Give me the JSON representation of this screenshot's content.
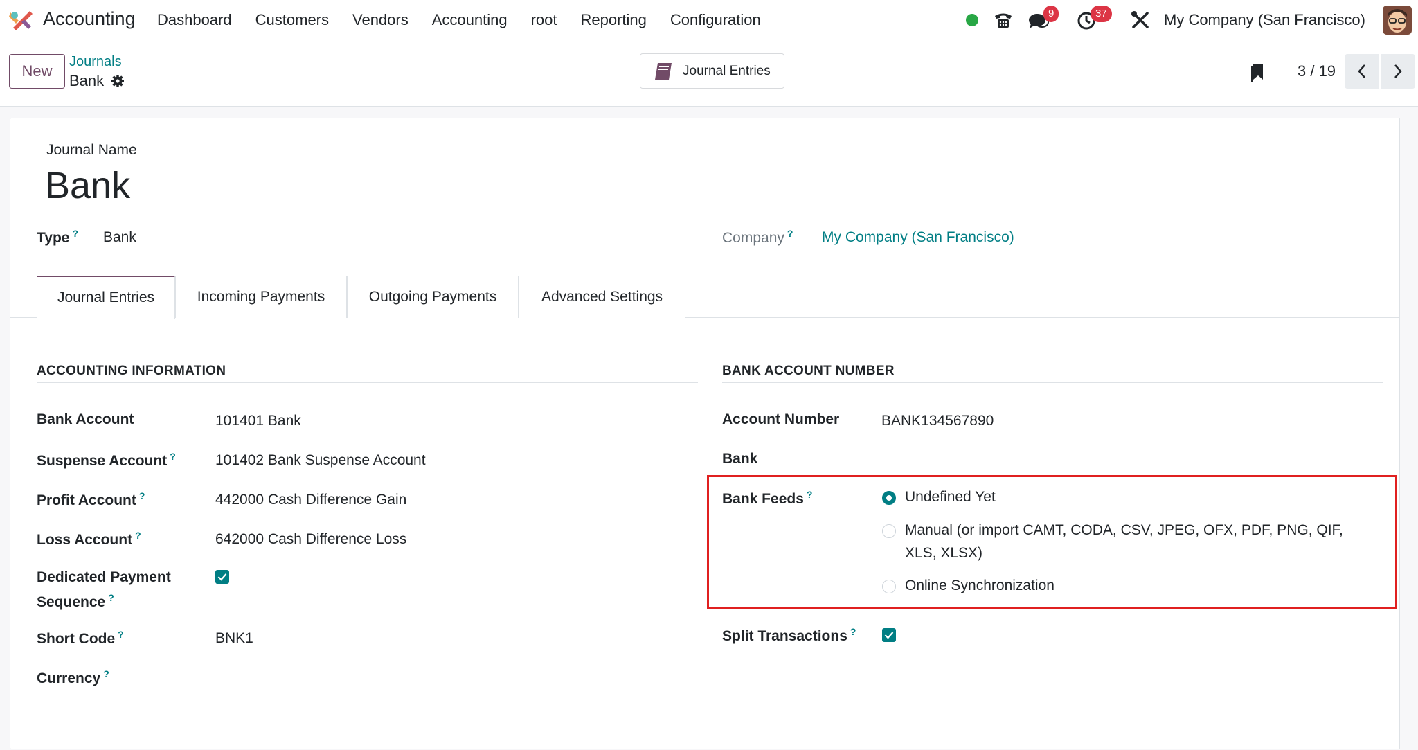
{
  "navbar": {
    "app_name": "Accounting",
    "menu": [
      "Dashboard",
      "Customers",
      "Vendors",
      "Accounting",
      "root",
      "Reporting",
      "Configuration"
    ],
    "messages_count": "9",
    "activities_count": "37",
    "company": "My Company (San Francisco)",
    "icons": [
      "app-logo-icon",
      "phone-icon",
      "chat-icon",
      "clock-icon",
      "tools-icon"
    ]
  },
  "control_panel": {
    "new_label": "New",
    "breadcrumb_parent": "Journals",
    "breadcrumb_current": "Bank",
    "smart_button": "Journal Entries",
    "pager": "3 / 19"
  },
  "form": {
    "journal_name_label": "Journal Name",
    "journal_name": "Bank",
    "type_label": "Type",
    "type_value": "Bank",
    "company_label": "Company",
    "company_value": "My Company (San Francisco)",
    "help_mark": "?",
    "tabs": [
      "Journal Entries",
      "Incoming Payments",
      "Outgoing Payments",
      "Advanced Settings"
    ],
    "accounting": {
      "title": "ACCOUNTING INFORMATION",
      "bank_account_label": "Bank Account",
      "bank_account": "101401 Bank",
      "suspense_label": "Suspense Account",
      "suspense": "101402 Bank Suspense Account",
      "profit_label": "Profit Account",
      "profit": "442000 Cash Difference Gain",
      "loss_label": "Loss Account",
      "loss": "642000 Cash Difference Loss",
      "dedicated_label_1": "Dedicated Payment",
      "dedicated_label_2": "Sequence",
      "dedicated_checked": true,
      "short_code_label": "Short Code",
      "short_code": "BNK1",
      "currency_label": "Currency"
    },
    "bank_account": {
      "title": "BANK ACCOUNT NUMBER",
      "account_number_label": "Account Number",
      "account_number": "BANK134567890",
      "bank_label": "Bank",
      "feeds_label": "Bank Feeds",
      "feed_options": [
        "Undefined Yet",
        "Manual (or import CAMT, CODA, CSV, JPEG, OFX, PDF, PNG, QIF,",
        "XLS, XLSX)",
        "Online Synchronization"
      ],
      "feed_selected": "Undefined Yet",
      "split_label": "Split Transactions",
      "split_checked": true
    }
  },
  "colors": {
    "brand": "#714b67",
    "link": "#017e84",
    "highlight": "#e02020",
    "badge": "#dc3545",
    "presence": "#28a745"
  }
}
